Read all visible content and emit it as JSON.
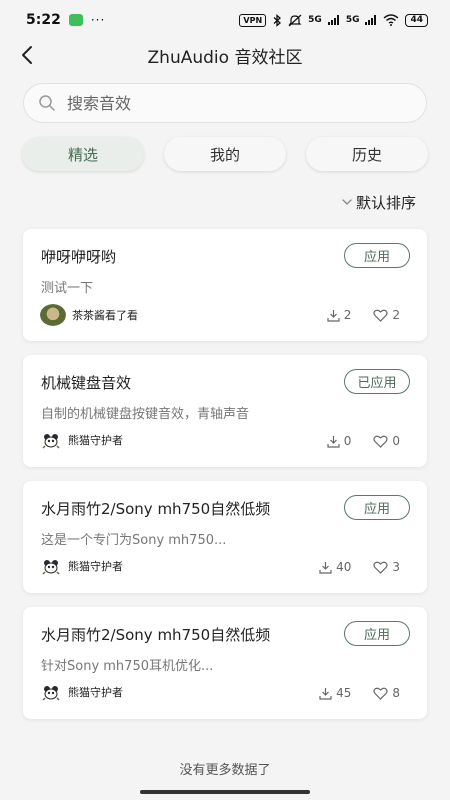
{
  "status": {
    "time": "5:22",
    "vpn": "VPN",
    "sig1": "5G",
    "sig2": "5G",
    "battery": "44"
  },
  "header": {
    "title": "ZhuAudio 音效社区"
  },
  "search": {
    "placeholder": "搜索音效"
  },
  "tabs": [
    {
      "label": "精选"
    },
    {
      "label": "我的"
    },
    {
      "label": "历史"
    }
  ],
  "sort": {
    "label": "默认排序"
  },
  "cards": [
    {
      "title": "咿呀咿呀哟",
      "desc": "测试一下",
      "author": "茶茶酱看了看",
      "button": "应用",
      "downloads": "2",
      "likes": "2"
    },
    {
      "title": "机械键盘音效",
      "desc": "自制的机械键盘按键音效，青轴声音",
      "author": "熊猫守护者",
      "button": "已应用",
      "downloads": "0",
      "likes": "0"
    },
    {
      "title": "水月雨竹2/Sony mh750自然低频",
      "desc": "这是一个专门为Sony mh750...",
      "author": "熊猫守护者",
      "button": "应用",
      "downloads": "40",
      "likes": "3"
    },
    {
      "title": "水月雨竹2/Sony mh750自然低频",
      "desc": "针对Sony mh750耳机优化...",
      "author": "熊猫守护者",
      "button": "应用",
      "downloads": "45",
      "likes": "8"
    }
  ],
  "footer": {
    "text": "没有更多数据了"
  },
  "colors": {
    "accent": "#4c6a56",
    "background": "#f4f4f4"
  }
}
